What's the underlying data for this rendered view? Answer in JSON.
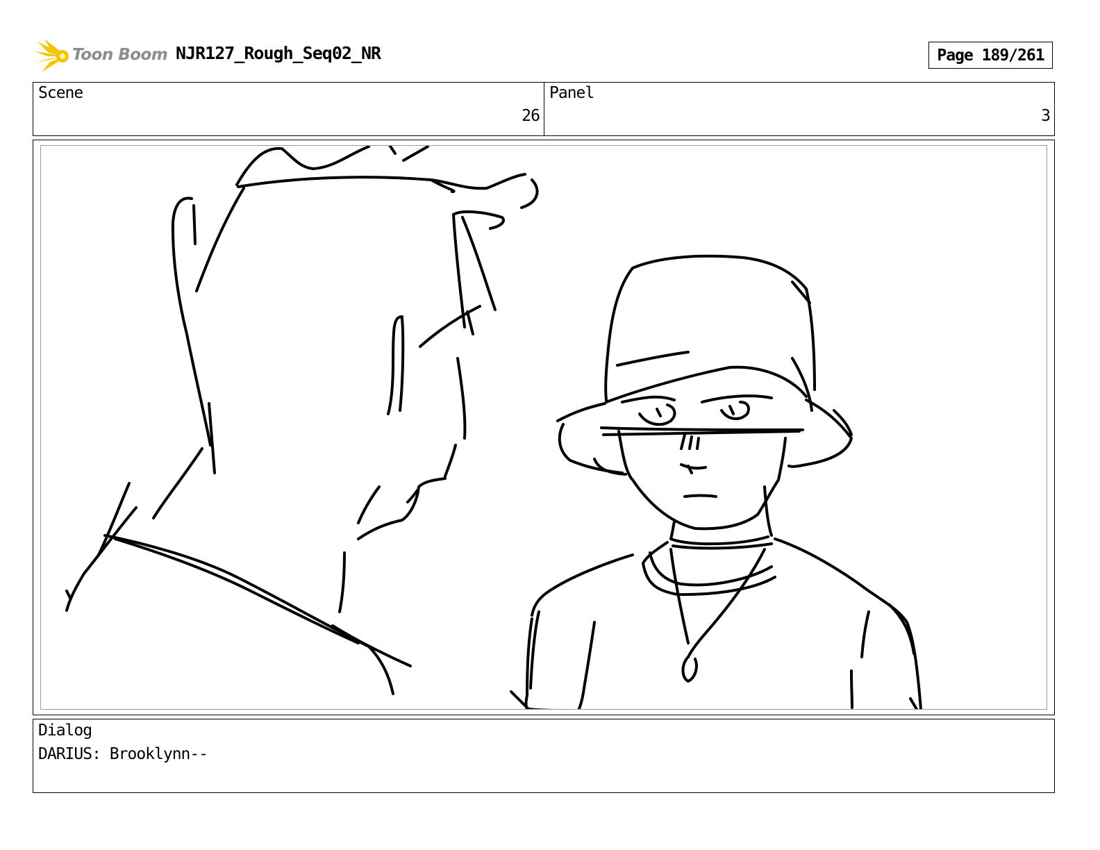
{
  "header": {
    "logo_text": "Toon Boom",
    "doc_title": "NJR127_Rough_Seq02_NR",
    "page_label": "Page 189/261"
  },
  "info": {
    "scene_label": "Scene",
    "scene_value": "26",
    "panel_label": "Panel",
    "panel_value": "3"
  },
  "dialog": {
    "label": "Dialog",
    "text": "DARIUS: Brooklynn--"
  },
  "colors": {
    "logo_star": "#f5c400",
    "logo_text": "#8c8c8c",
    "ink": "#000000",
    "inner_frame": "#9a9a9a"
  }
}
